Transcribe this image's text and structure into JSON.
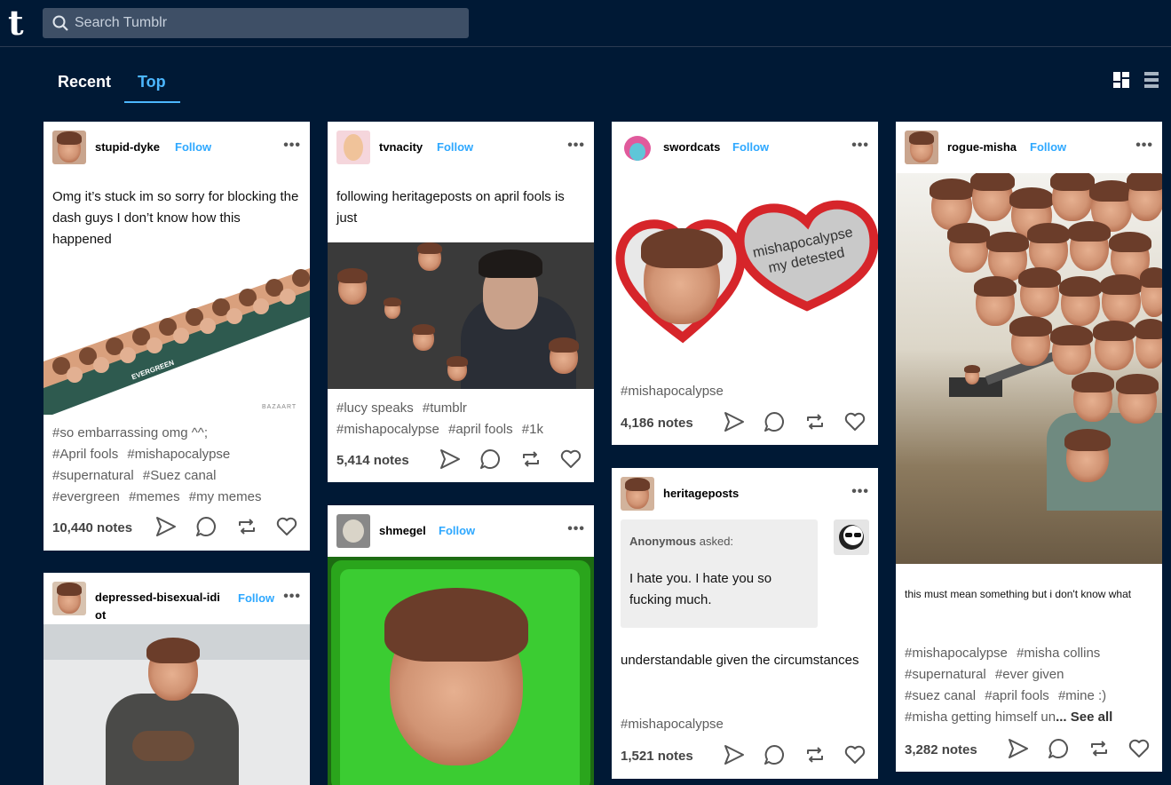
{
  "app": {
    "logo": "t",
    "search_placeholder": "Search Tumblr"
  },
  "tabs": [
    {
      "label": "Recent"
    },
    {
      "label": "Top"
    }
  ],
  "follow_label": "Follow",
  "more_label": "•••",
  "posts": {
    "stupid_dyke": {
      "username": "stupid-dyke",
      "text": "Omg it’s stuck im so sorry for blocking the dash guys I don’t know how this happened",
      "image_caption": "EVERGREEN",
      "image_credit": "BAZAART",
      "tags": [
        "#so embarrassing omg ^^;",
        "#April fools",
        "#mishapocalypse",
        "#supernatural",
        "#Suez canal",
        "#evergreen",
        "#memes",
        "#my memes"
      ],
      "notes": "10,440 notes"
    },
    "tvnacity": {
      "username": "tvnacity",
      "text": "following heritageposts on april fools is just",
      "tags": [
        "#lucy speaks",
        "#tumblr",
        "#mishapocalypse",
        "#april fools",
        "#1k"
      ],
      "notes": "5,414 notes"
    },
    "swordcats": {
      "username": "swordcats",
      "image_text_1": "mishapocalypse",
      "image_text_2": "my detested",
      "tags": [
        "#mishapocalypse"
      ],
      "notes": "4,186 notes"
    },
    "rogue_misha": {
      "username": "rogue-misha",
      "text": "this must mean something but i don't know what",
      "tags": [
        "#mishapocalypse",
        "#misha collins",
        "#supernatural",
        "#ever given",
        "#suez canal",
        "#april fools",
        "#mine :)"
      ],
      "last_tag": "#misha getting himself un",
      "see_all": "... See all",
      "notes": "3,282 notes"
    },
    "heritageposts": {
      "username": "heritageposts",
      "asker": "Anonymous",
      "asked": " asked:",
      "question": "I hate you. I hate you so fucking much.",
      "answer": "understandable given the circumstances",
      "tags": [
        "#mishapocalypse"
      ],
      "notes": "1,521 notes"
    },
    "shmegel": {
      "username": "shmegel"
    },
    "depressed": {
      "username": "depressed-bisexual-idi\not"
    }
  },
  "colors": {
    "background": "#001935",
    "accent": "#4cb7ff",
    "follow": "#2ea8ff"
  },
  "icons": [
    "share-icon",
    "reply-icon",
    "reblog-icon",
    "like-icon",
    "dashboard-grid-icon",
    "dashboard-list-icon",
    "search-icon"
  ]
}
